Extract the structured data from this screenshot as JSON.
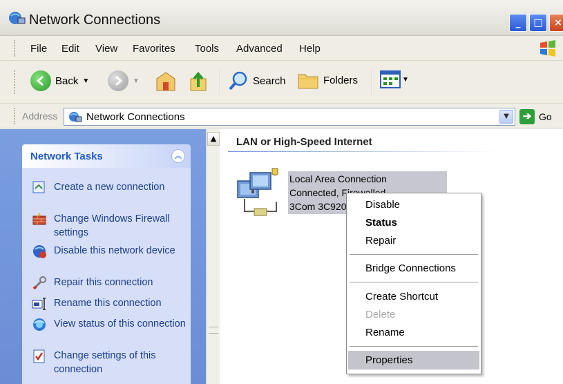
{
  "window": {
    "title": "Network Connections"
  },
  "menubar": {
    "items": [
      "File",
      "Edit",
      "View",
      "Favorites",
      "Tools",
      "Advanced",
      "Help"
    ]
  },
  "toolbar": {
    "back": "Back",
    "search": "Search",
    "folders": "Folders"
  },
  "address": {
    "label": "Address",
    "value": "Network Connections",
    "go": "Go"
  },
  "tasks": {
    "title": "Network Tasks",
    "items": [
      {
        "label": "Create a new connection",
        "icon": "new-connection-icon"
      },
      {
        "label": "Change Windows Firewall settings",
        "icon": "firewall-icon"
      },
      {
        "label": "Disable this network device",
        "icon": "disable-device-icon"
      },
      {
        "label": "Repair this connection",
        "icon": "repair-icon"
      },
      {
        "label": "Rename this connection",
        "icon": "rename-icon"
      },
      {
        "label": "View status of this connection",
        "icon": "status-icon"
      },
      {
        "label": "Change settings of this connection",
        "icon": "settings-icon"
      }
    ]
  },
  "content": {
    "group_title": "LAN or High-Speed Internet",
    "connection": {
      "name": "Local Area Connection",
      "status": "Connected, Firewalled",
      "device": "3Com 3C920"
    }
  },
  "context_menu": {
    "disable": "Disable",
    "status": "Status",
    "repair": "Repair",
    "bridge": "Bridge Connections",
    "shortcut": "Create Shortcut",
    "delete": "Delete",
    "rename": "Rename",
    "properties": "Properties"
  }
}
